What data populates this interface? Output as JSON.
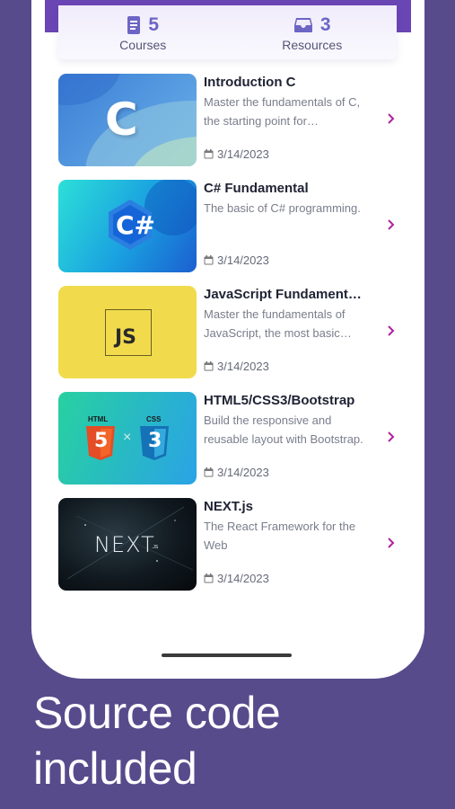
{
  "stats": [
    {
      "icon": "document-icon",
      "count": "5",
      "label": "Courses"
    },
    {
      "icon": "inbox-icon",
      "count": "3",
      "label": "Resources"
    }
  ],
  "courses": [
    {
      "title": "Introduction C",
      "desc": "Master the fundamentals of C, the starting point for programming.",
      "date": "3/14/2023",
      "thumb_text": "C"
    },
    {
      "title": "C# Fundamental",
      "desc": "The basic of C# programming.",
      "date": "3/14/2023",
      "thumb_text": "C#"
    },
    {
      "title": "JavaScript Fundamentals",
      "desc": "Master the fundamentals of JavaScript, the most basic language of the web.",
      "date": "3/14/2023",
      "thumb_text": "JS"
    },
    {
      "title": "HTML5/CSS3/Bootstrap",
      "desc": "Build the responsive and reusable layout with Bootstrap.",
      "date": "3/14/2023",
      "thumb_text": [
        "HTML",
        "CSS",
        "5",
        "3"
      ]
    },
    {
      "title": "NEXT.js",
      "desc": "The React Framework for the Web",
      "date": "3/14/2023",
      "thumb_text": [
        "NEXT",
        ".JS"
      ]
    }
  ],
  "headline": [
    "Source code",
    "included"
  ],
  "colors": {
    "accent": "#6d65c4",
    "chevron": "#b0219e",
    "background": "#574b8c"
  }
}
